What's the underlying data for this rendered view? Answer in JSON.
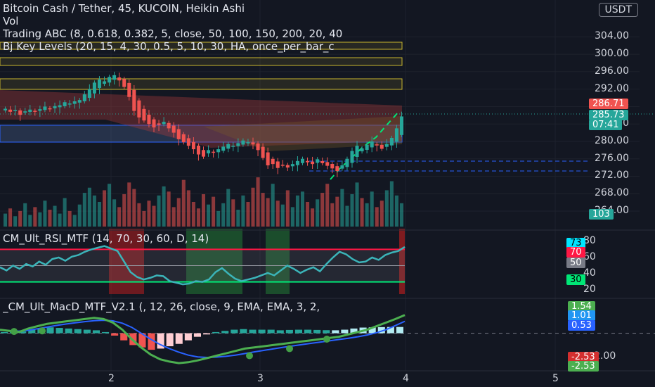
{
  "header": {
    "title": "Bitcoin Cash / Tether, 45, KUCOIN, Heikin Ashi",
    "indicators": [
      "Vol",
      "Trading ABC (8, 0.618, 0.382, 5, close, 50, 100, 150, 200, 20, 40",
      "Bj Key Levels (20, 15, 4, 30, 0.5, 5, 10, 30, HA, once_per_bar_c"
    ],
    "currency": "USDT"
  },
  "price_axis": {
    "ticks": [
      "304.00",
      "300.00",
      "296.00",
      "292.00",
      "288.00",
      "284.00",
      "280.00",
      "276.00",
      "272.00",
      "268.00",
      "264.00"
    ],
    "badges": [
      {
        "label": "286.71",
        "color": "#f05350"
      },
      {
        "label": "285.73",
        "color": "#26a69a"
      },
      {
        "label": "07:41",
        "color": "#26a69a"
      },
      {
        "label": "103",
        "color": "#26a69a"
      }
    ]
  },
  "rsi_panel": {
    "title": "CM_Ult_RSI_MTF (14, 70, 30, 60, D, 14)",
    "ticks": [
      "80",
      "60",
      "40",
      "20"
    ],
    "badges": [
      {
        "label": "73",
        "color": "#00e5ff",
        "text": "#000"
      },
      {
        "label": "70",
        "color": "#ff1744",
        "text": "#fff"
      },
      {
        "label": "50",
        "color": "#787b86",
        "text": "#fff"
      },
      {
        "label": "30",
        "color": "#00e676",
        "text": "#000"
      }
    ]
  },
  "macd_panel": {
    "title": "_CM_Ult_MacD_MTF_V2.1 (, 12, 26, close, 9, EMA, EMA, 3, 2,",
    "ticks": [
      "-2.00"
    ],
    "badges": [
      {
        "label": "1.54",
        "color": "#4caf50"
      },
      {
        "label": "1.01",
        "color": "#2196f3"
      },
      {
        "label": "0.53",
        "color": "#2962ff"
      },
      {
        "label": "-2.53",
        "color": "#d32f2f"
      },
      {
        "label": "-2.53",
        "color": "#4caf50"
      }
    ]
  },
  "time_axis": {
    "ticks": [
      "2",
      "3",
      "4",
      "5"
    ]
  },
  "chart_data": {
    "type": "candlestick",
    "style": "Heikin Ashi",
    "symbol": "BCH/USDT",
    "interval": "45",
    "price_ylim": [
      264,
      306
    ],
    "last_price": 285.73,
    "close_series": [
      287.5,
      286.8,
      287.2,
      286.1,
      286.9,
      287.3,
      287.0,
      287.4,
      288.0,
      287.6,
      288.1,
      288.3,
      289.0,
      288.7,
      289.2,
      289.5,
      290.8,
      292.0,
      293.5,
      294.2,
      293.8,
      294.8,
      295.2,
      294.0,
      292.5,
      290.2,
      287.0,
      285.5,
      284.8,
      284.0,
      283.2,
      283.8,
      284.5,
      283.0,
      282.0,
      280.5,
      279.8,
      279.0,
      278.2,
      277.0,
      276.5,
      278.0,
      277.4,
      278.2,
      278.8,
      279.4,
      279.0,
      279.6,
      280.2,
      279.8,
      279.3,
      278.0,
      276.2,
      274.5,
      274.8,
      273.9,
      274.5,
      274.0,
      274.8,
      275.5,
      276.0,
      275.2,
      274.8,
      275.9,
      275.0,
      274.4,
      273.8,
      273.2,
      274.5,
      276.0,
      277.8,
      279.0,
      278.4,
      279.2,
      280.0,
      279.1,
      278.3,
      279.4,
      280.8,
      283.0,
      285.73
    ],
    "volume_series": [
      10,
      14,
      8,
      12,
      18,
      9,
      15,
      11,
      20,
      13,
      16,
      10,
      22,
      12,
      9,
      17,
      26,
      30,
      24,
      19,
      28,
      33,
      21,
      15,
      25,
      34,
      29,
      18,
      12,
      20,
      16,
      24,
      31,
      27,
      15,
      22,
      36,
      28,
      19,
      14,
      25,
      17,
      23,
      12,
      18,
      29,
      21,
      13,
      24,
      19,
      30,
      38,
      26,
      22,
      33,
      20,
      17,
      28,
      15,
      24,
      27,
      19,
      14,
      21,
      26,
      33,
      18,
      23,
      29,
      16,
      25,
      34,
      22,
      18,
      27,
      15,
      20,
      28,
      35,
      24,
      18
    ],
    "rsi_values": [
      48,
      44,
      50,
      46,
      52,
      49,
      55,
      51,
      58,
      60,
      56,
      61,
      63,
      67,
      70,
      72,
      74,
      71,
      68,
      55,
      42,
      36,
      33,
      35,
      38,
      37,
      31,
      29,
      27,
      28,
      31,
      30,
      33,
      42,
      47,
      40,
      34,
      31,
      33,
      35,
      38,
      41,
      38,
      44,
      50,
      46,
      41,
      45,
      48,
      43,
      52,
      60,
      67,
      64,
      58,
      54,
      55,
      60,
      57,
      63,
      66,
      68,
      73
    ],
    "macd_values": [
      0.3,
      0.2,
      0.1,
      0.4,
      0.6,
      0.8,
      0.9,
      1.0,
      1.1,
      1.2,
      1.3,
      1.2,
      0.9,
      0.3,
      -0.5,
      -1.2,
      -1.8,
      -2.2,
      -2.4,
      -2.53,
      -2.45,
      -2.3,
      -2.1,
      -1.9,
      -1.7,
      -1.5,
      -1.3,
      -1.2,
      -1.1,
      -1.0,
      -0.9,
      -0.8,
      -0.7,
      -0.6,
      -0.5,
      -0.4,
      -0.3,
      -0.1,
      0.1,
      0.3,
      0.6,
      0.9,
      1.2,
      1.54
    ],
    "signal_values": [
      0.25,
      0.22,
      0.18,
      0.25,
      0.38,
      0.52,
      0.66,
      0.78,
      0.88,
      0.98,
      1.06,
      1.1,
      1.05,
      0.85,
      0.5,
      0.0,
      -0.5,
      -0.95,
      -1.3,
      -1.6,
      -1.85,
      -2.0,
      -2.05,
      -2.02,
      -1.95,
      -1.85,
      -1.72,
      -1.58,
      -1.45,
      -1.33,
      -1.2,
      -1.08,
      -0.97,
      -0.86,
      -0.75,
      -0.64,
      -0.53,
      -0.42,
      -0.3,
      -0.15,
      0.05,
      0.3,
      0.65,
      1.01
    ],
    "histogram_values": [
      0.1,
      0.2,
      0.15,
      0.3,
      0.4,
      0.5,
      0.45,
      0.4,
      0.35,
      0.3,
      0.25,
      0.1,
      -0.2,
      -0.6,
      -1.0,
      -1.2,
      -1.4,
      -1.3,
      -1.1,
      -0.9,
      -0.6,
      -0.3,
      -0.1,
      0.1,
      0.2,
      0.3,
      0.35,
      0.3,
      0.3,
      0.3,
      0.25,
      0.28,
      0.3,
      0.3,
      0.28,
      0.26,
      0.25,
      0.3,
      0.4,
      0.48,
      0.5,
      0.52,
      0.53,
      0.53
    ]
  }
}
